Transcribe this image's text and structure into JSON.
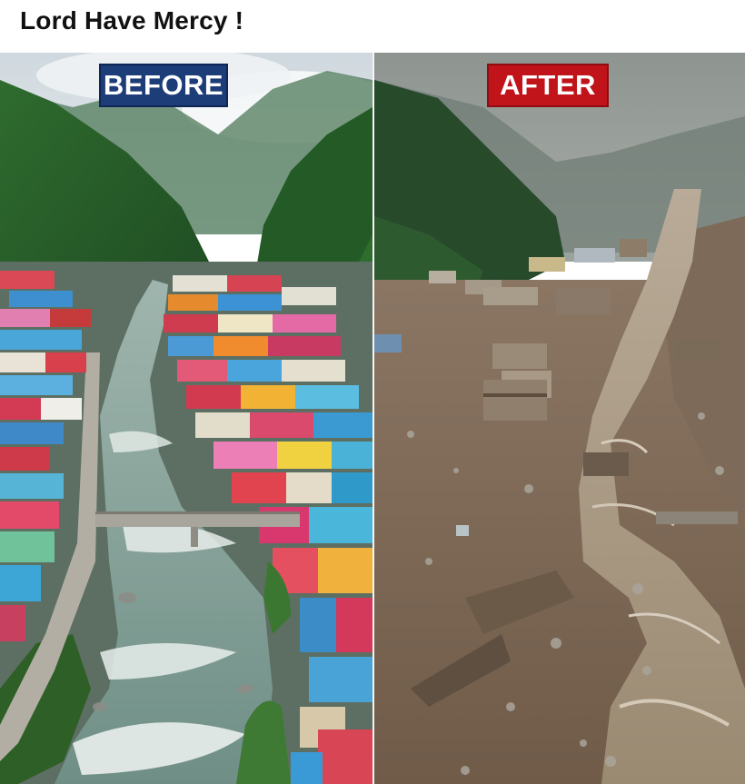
{
  "post": {
    "title": "Lord Have Mercy !"
  },
  "photo": {
    "before_label": "BEFORE",
    "after_label": "AFTER",
    "before_label_color": "#1d3d78",
    "after_label_color": "#c0141a"
  }
}
